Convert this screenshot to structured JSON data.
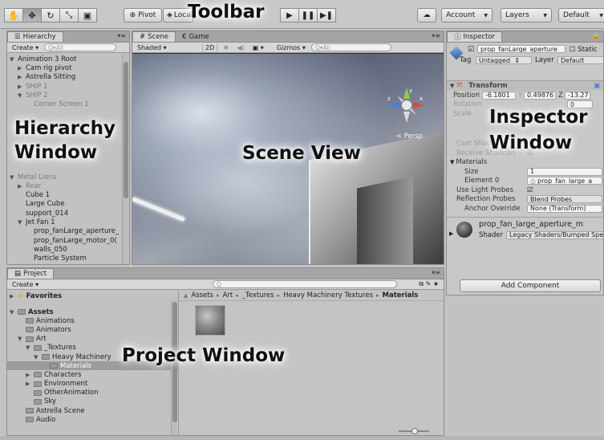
{
  "toolbar": {
    "pivot_label": "Pivot",
    "local_label": "Local",
    "account_label": "Account",
    "layers_label": "Layers",
    "layout_label": "Default"
  },
  "annotations": {
    "toolbar": "Toolbar",
    "hierarchy_line1": "Hierarchy",
    "hierarchy_line2": "Window",
    "scene": "Scene View",
    "inspector_line1": "Inspector",
    "inspector_line2": "Window",
    "project": "Project Window"
  },
  "hierarchy": {
    "tab_label": "Hierarchy",
    "create_label": "Create",
    "search_placeholder": "Q▾All",
    "items": [
      {
        "label": "Animation 3 Root",
        "indent": 0,
        "arrow": "▼",
        "dim": false
      },
      {
        "label": "Cam rig pivot",
        "indent": 1,
        "arrow": "▶",
        "dim": false
      },
      {
        "label": "Astrella Sitting",
        "indent": 1,
        "arrow": "▶",
        "dim": false
      },
      {
        "label": "SHIP 1",
        "indent": 1,
        "arrow": "▶",
        "dim": true
      },
      {
        "label": "SHIP 2",
        "indent": 1,
        "arrow": "▼",
        "dim": true
      },
      {
        "label": "Corner Screen 1",
        "indent": 2,
        "arrow": "",
        "dim": true
      },
      {
        "label": "",
        "indent": 0,
        "arrow": "",
        "dim": false
      },
      {
        "label": "",
        "indent": 0,
        "arrow": "",
        "dim": false
      },
      {
        "label": "",
        "indent": 0,
        "arrow": "",
        "dim": false
      },
      {
        "label": "",
        "indent": 0,
        "arrow": "",
        "dim": false
      },
      {
        "label": "",
        "indent": 0,
        "arrow": "",
        "dim": false
      },
      {
        "label": "",
        "indent": 0,
        "arrow": "",
        "dim": false
      },
      {
        "label": "",
        "indent": 0,
        "arrow": "",
        "dim": false
      },
      {
        "label": "Metal Lions",
        "indent": 0,
        "arrow": "▼",
        "dim": true
      },
      {
        "label": "Rear",
        "indent": 1,
        "arrow": "▶",
        "dim": true
      },
      {
        "label": "Cube 1",
        "indent": 1,
        "arrow": "",
        "dim": false
      },
      {
        "label": "Large Cube",
        "indent": 1,
        "arrow": "",
        "dim": false
      },
      {
        "label": "support_014",
        "indent": 1,
        "arrow": "",
        "dim": false
      },
      {
        "label": "Jet Fan 1",
        "indent": 1,
        "arrow": "▼",
        "dim": false
      },
      {
        "label": "prop_fanLarge_aperture_",
        "indent": 2,
        "arrow": "",
        "dim": false
      },
      {
        "label": "prop_fanLarge_motor_0(",
        "indent": 2,
        "arrow": "",
        "dim": false
      },
      {
        "label": "walls_050",
        "indent": 2,
        "arrow": "",
        "dim": false
      },
      {
        "label": "Particle System",
        "indent": 2,
        "arrow": "",
        "dim": false
      }
    ]
  },
  "scene": {
    "tab_scene": "Scene",
    "tab_game": "Game",
    "shaded_label": "Shaded",
    "mode_2d": "2D",
    "gizmos_label": "Gizmos",
    "search_placeholder": "Q▾All",
    "persp_label": "< Persp",
    "gizmo_x": "x",
    "gizmo_y": "y",
    "gizmo_z": "z"
  },
  "inspector": {
    "tab_label": "Inspector",
    "object_name": "prop_fanLarge_aperture_",
    "static_label": "Static",
    "tag_label": "Tag",
    "tag_value": "Untagged",
    "layer_label": "Layer",
    "layer_value": "Default",
    "transform_title": "Transform",
    "position_label": "Position",
    "pos_x_label": "X",
    "pos_x_value": "-6.1801",
    "pos_y_label": "Y",
    "pos_y_value": "0.49876",
    "pos_z_label": "Z",
    "pos_z_value": "-13.27",
    "rotation_label": "Rotation",
    "rot_z_value": "0",
    "scale_label": "Scale",
    "cast_shadows_label": "Cast Shadows",
    "receive_shadows_label": "Receive Shadows",
    "materials_label": "Materials",
    "size_label": "Size",
    "size_value": "1",
    "element0_label": "Element 0",
    "element0_value": "prop_fan_large_a",
    "light_probes_label": "Use Light Probes",
    "reflection_probes_label": "Reflection Probes",
    "reflection_probes_value": "Blend Probes",
    "anchor_override_label": "Anchor Override",
    "anchor_override_value": "None (Transform)",
    "material_name": "prop_fan_large_aperture_m",
    "shader_label": "Shader",
    "shader_value": "Legacy Shaders/Bumped Spec",
    "add_component_label": "Add Component"
  },
  "project": {
    "tab_label": "Project",
    "create_label": "Create",
    "favorites_label": "Favorites",
    "assets_label": "Assets",
    "tree": [
      {
        "label": "Animations",
        "indent": 1,
        "arrow": "",
        "selected": false
      },
      {
        "label": "Animators",
        "indent": 1,
        "arrow": "",
        "selected": false
      },
      {
        "label": "Art",
        "indent": 1,
        "arrow": "▼",
        "selected": false
      },
      {
        "label": "_Textures",
        "indent": 2,
        "arrow": "▼",
        "selected": false
      },
      {
        "label": "Heavy Machinery",
        "indent": 3,
        "arrow": "▼",
        "selected": false
      },
      {
        "label": "Materials",
        "indent": 4,
        "arrow": "",
        "selected": true
      },
      {
        "label": "Characters",
        "indent": 2,
        "arrow": "▶",
        "selected": false
      },
      {
        "label": "Environment",
        "indent": 2,
        "arrow": "▶",
        "selected": false
      },
      {
        "label": "OtherAnimation",
        "indent": 2,
        "arrow": "",
        "selected": false
      },
      {
        "label": "Sky",
        "indent": 2,
        "arrow": "",
        "selected": false
      },
      {
        "label": "Astrella Scene",
        "indent": 1,
        "arrow": "",
        "selected": false
      },
      {
        "label": "Audio",
        "indent": 1,
        "arrow": "",
        "selected": false
      }
    ],
    "breadcrumb": [
      "Assets",
      "Art",
      "_Textures",
      "Heavy Machinery Textures",
      "Materials"
    ]
  }
}
